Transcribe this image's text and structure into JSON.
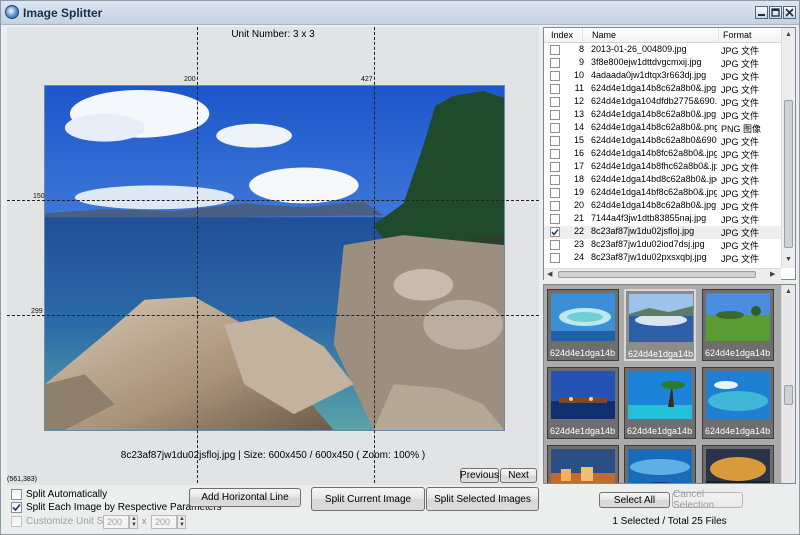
{
  "window": {
    "title": "Image Splitter"
  },
  "canvas": {
    "unit_number": "Unit Number: 3 x 3",
    "x_splits": [
      "200",
      "427"
    ],
    "y_splits": [
      "150",
      "299"
    ],
    "image_info": "8c23af87jw1du02jsfloj.jpg  |  Size: 600x450 / 600x450 ( Zoom: 100% )",
    "cursor_pos": "(561,383)"
  },
  "nav": {
    "previous_label": "Previous",
    "next_label": "Next"
  },
  "options": {
    "split_auto_label": "Split Automatically",
    "split_each_label": "Split Each Image by Respective Parameters",
    "customize_label": "Customize Unit Size",
    "width_value": "200",
    "times": "x",
    "height_value": "200"
  },
  "buttons": {
    "add_horizontal_line": "Add Horizontal Line",
    "split_current": "Split Current Image",
    "split_selected": "Split Selected Images",
    "select_all": "Select All",
    "cancel_selection": "Cancel Selection"
  },
  "list": {
    "columns": [
      "Index",
      "Name",
      "Format"
    ],
    "rows": [
      {
        "index": "8",
        "name": "2013-01-26_004809.jpg",
        "format": "JPG 文件",
        "checked": false
      },
      {
        "index": "9",
        "name": "3f8e800ejw1dttdvgcmxij.jpg",
        "format": "JPG 文件",
        "checked": false
      },
      {
        "index": "10",
        "name": "4adaada0jw1dtqx3r663dj.jpg",
        "format": "JPG 文件",
        "checked": false
      },
      {
        "index": "11",
        "name": "624d4e1dga14b8c62a8b0&.jpg",
        "format": "JPG 文件",
        "checked": false
      },
      {
        "index": "12",
        "name": "624d4e1dga104dfdb2775&690....",
        "format": "JPG 文件",
        "checked": false
      },
      {
        "index": "13",
        "name": "624d4e1dga14b8c62a8b0&.jpg",
        "format": "JPG 文件",
        "checked": false
      },
      {
        "index": "14",
        "name": "624d4e1dga14b8c62a8b0&.png",
        "format": "PNG 图像",
        "checked": false
      },
      {
        "index": "15",
        "name": "624d4e1dga14b8c62a8b0&690....",
        "format": "JPG 文件",
        "checked": false
      },
      {
        "index": "16",
        "name": "624d4e1dga14b8fc62a8b0&.jpg",
        "format": "JPG 文件",
        "checked": false
      },
      {
        "index": "17",
        "name": "624d4e1dga14b8fhc62a8b0&.jpg",
        "format": "JPG 文件",
        "checked": false
      },
      {
        "index": "18",
        "name": "624d4e1dga14bd8c62a8b0&.jpg",
        "format": "JPG 文件",
        "checked": false
      },
      {
        "index": "19",
        "name": "624d4e1dga14bf8c62a8b0&.jpg",
        "format": "JPG 文件",
        "checked": false
      },
      {
        "index": "20",
        "name": "624d4e1dga14b8c62a8b0&.jpg",
        "format": "JPG 文件",
        "checked": false
      },
      {
        "index": "21",
        "name": "7144a4f3jw1dtb83855naj.jpg",
        "format": "JPG 文件",
        "checked": false
      },
      {
        "index": "22",
        "name": "8c23af87jw1du02jsfloj.jpg",
        "format": "JPG 文件",
        "checked": true
      },
      {
        "index": "23",
        "name": "8c23af87jw1du02iod7dsj.jpg",
        "format": "JPG 文件",
        "checked": false
      },
      {
        "index": "24",
        "name": "8c23af87jw1du02pxsxqbj.jpg",
        "format": "JPG 文件",
        "checked": false
      }
    ]
  },
  "thumbnails": [
    {
      "caption": "624d4e1dga14b...",
      "scene": "lagoon",
      "selected": false
    },
    {
      "caption": "624d4e1dga14b...",
      "scene": "bay",
      "selected": true
    },
    {
      "caption": "624d4e1dga14b...",
      "scene": "green",
      "selected": false
    },
    {
      "caption": "624d4e1dga14b...",
      "scene": "resort",
      "selected": false
    },
    {
      "caption": "624d4e1dga14b...",
      "scene": "palms",
      "selected": false
    },
    {
      "caption": "624d4e1dga14b...",
      "scene": "reef",
      "selected": false
    },
    {
      "caption": "",
      "scene": "sunset-town",
      "selected": false
    },
    {
      "caption": "",
      "scene": "underwater",
      "selected": false
    },
    {
      "caption": "",
      "scene": "orange-sky",
      "selected": false
    }
  ],
  "status": {
    "summary": "1 Selected / Total 25 Files"
  },
  "colors": {
    "titlebar": "#c8d6e5",
    "thumb_panel": "#ababab",
    "selection": "#eeeeee"
  }
}
